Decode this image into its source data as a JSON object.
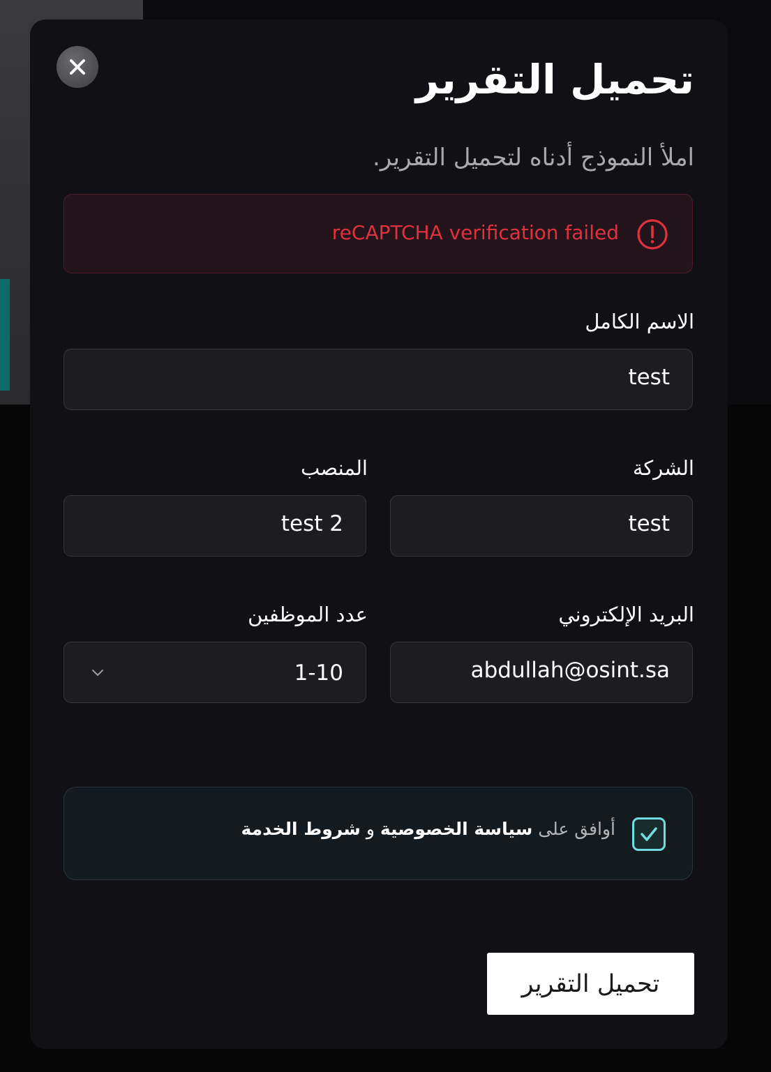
{
  "modal": {
    "title": "تحميل التقرير",
    "subtitle": "املأ النموذج أدناه لتحميل التقرير."
  },
  "alert": {
    "message": "reCAPTCHA verification failed",
    "color": "#e0313f"
  },
  "form": {
    "full_name": {
      "label": "الاسم الكامل",
      "value": "test"
    },
    "company": {
      "label": "الشركة",
      "value": "test"
    },
    "position": {
      "label": "المنصب",
      "value": "test 2"
    },
    "email": {
      "label": "البريد الإلكتروني",
      "value": "abdullah@osint.sa"
    },
    "employees": {
      "label": "عدد الموظفين",
      "value": "1-10"
    }
  },
  "consent": {
    "checked": true,
    "prefix": "أوافق على",
    "privacy_link": "سياسة الخصوصية",
    "conjunction": "و",
    "terms_link": "شروط الخدمة",
    "accent_color": "#70dde0"
  },
  "submit_label": "تحميل التقرير"
}
